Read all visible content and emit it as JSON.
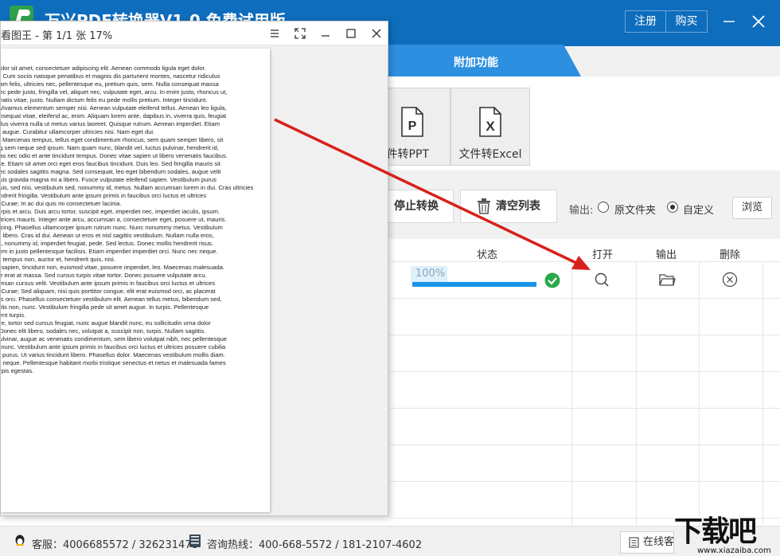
{
  "app": {
    "title": "万兴PDF转换器V1.0 免费试用版",
    "register_label": "注册",
    "buy_label": "购买"
  },
  "tabs": {
    "active_label": "附加功能"
  },
  "features": [
    {
      "label": "文件转PPT",
      "visible_label": "件转PPT",
      "icon": "ppt-file-icon"
    },
    {
      "label": "文件转Excel",
      "visible_label": "文件转Excel",
      "icon": "excel-file-icon"
    }
  ],
  "toolbar": {
    "stop_label": "停止转换",
    "clear_label": "清空列表",
    "output_label": "输出:",
    "option_source": "原文件夹",
    "option_custom": "自定义",
    "selected_option": "自定义",
    "browse_label": "浏览"
  },
  "table": {
    "headers": {
      "status": "状态",
      "open": "打开",
      "output": "输出",
      "delete": "删除"
    },
    "rows": [
      {
        "progress_text": "100%",
        "progress": 1.0,
        "status": "done"
      }
    ]
  },
  "statusbar": {
    "service": "客服：4006685572 / 326231478",
    "hotline": "咨询热线：400-668-5572 / 181-2107-4602",
    "online_label": "在线客服"
  },
  "viewer": {
    "title": "看图王 - 第 1/1 张 17%",
    "page_lines": [
      "dolor sit amet, consectetuer adipiscing elit. Aenean commodo ligula eget dolor.",
      "a. Cum sociis natoque penatibus et magnis dis parturient montes, nascetur ridiculus",
      "uam felis, ultricies nec, pellentesque eu, pretium quis, sem. Nulla consequat massa",
      "nec pede justo, fringilla vel, aliquet nec, vulputate eget, arcu. In enim justo, rhoncus ut,",
      "enatis vitae, justo. Nullam dictum felis eu pede mollis pretium. Integer tincidunt.",
      ". Vivamus elementum semper nisi. Aenean vulputate eleifend tellus. Aenean leo ligula,",
      "onsequat vitae, eleifend ac, enim. Aliquam lorem ante, dapibus in, viverra quis, feugiat",
      "ellus viverra nulla ut metus varius laoreet. Quisque rutrum. Aenean imperdiet. Etiam",
      "el augue. Curabitur ullamcorper ultricies nisi. Nam eget dui.",
      "s. Maecenas tempus, tellus eget condimentum rhoncus, sem quam semper libero, sit",
      "ng sem neque sed ipsum. Nam quam nunc, blandit vel, luctus pulvinar, hendrerit id,",
      "nas nec odio et ante tincidunt tempus. Donec vitae sapien ut libero venenatis faucibus.",
      "nte. Etiam sit amet orci eget eros faucibus tincidunt. Duis leo. Sed fringilla mauris sit",
      "nec sodales sagittis magna. Sed consequat, leo eget bibendum sodales, augue velit",
      "quis gravida magna mi a libero. Fusce vulputate eleifend sapien. Vestibulum purus",
      "quis, sed nisi, vestibulum sed, nonummy id, metus. Nullam accumsan lorem in dui. Cras ultricies",
      "endrerit fringilla. Vestibulum ante ipsum primis in faucibus orci luctus et ultrices",
      "a Curae; In ac dui quis mi consectetuer lacinia.",
      "turpis et arcu. Duis arcu tortor, suscipit eget, imperdiet nec, imperdiet iaculis, ipsum.",
      "ultrices mauris. Integer ante arcu, accumsan a, consectetuer eget, posuere ut, mauris.",
      "iscing. Phasellus ullamcorper ipsum rutrum nunc. Nunc nonummy metus. Vestibulum",
      "m libero. Cras id dui. Aenean ut eros et nisl sagittis vestibulum. Nullam nulla eros,",
      "et, nonummy id, imperdiet feugiat, pede. Sed lectus. Donec mollis hendrerit risus.",
      "sem in justo pellentesque facilisis. Etiam imperdiet imperdiet orci. Nunc nec neque.",
      "a, tempus non, auctor et, hendrerit quis, nisi.",
      "a sapien, tincidunt non, euismod vitae, posuere imperdiet, leo. Maecenas malesuada.",
      "ue erat at massa. Sed cursus turpis vitae tortor. Donec posuere vulputate arcu.",
      "umsan cursus velit. Vestibulum ante ipsum primis in faucibus orci luctus et ultrices",
      "a Curae; Sed aliquam, nisi quis porttitor congue, elit erat euismod orci, ac placerat",
      "uis orci. Phasellus consectetuer vestibulum elit. Aenean tellus metus, bibendum sed,",
      "attis non, nunc. Vestibulum fringilla pede sit amet augue. In turpis. Pellentesque",
      "sent turpis.",
      "ere, tortor sed cursus feugiat, nunc augue blandit nunc, eu sollicitudin urna dolor",
      ". Donec elit libero, sodales nec, volutpat a, suscipit non, turpis. Nullam sagittis.",
      "pulvinar, augue ac venenatis condimentum, sem libero volutpat nibh, nec pellentesque",
      "a nunc. Vestibulum ante ipsum primis in faucibus orci luctus et ultrices posuere cubilia",
      "id purus. Ut varius tincidunt libero. Phasellus dolor. Maecenas vestibulum mollis diam.",
      "ut neque. Pellentesque habitant morbi tristique senectus et netus et malesuada fames",
      "urpis egestas."
    ]
  },
  "watermark": {
    "text": "下载吧",
    "url": "www.xiazaiba.com"
  },
  "colors": {
    "titlebar": "#0e6dbd",
    "tab_active": "#2d8fe0",
    "progress": "#1993e8",
    "success": "#2aa84a",
    "arrow": "#d8201b"
  }
}
